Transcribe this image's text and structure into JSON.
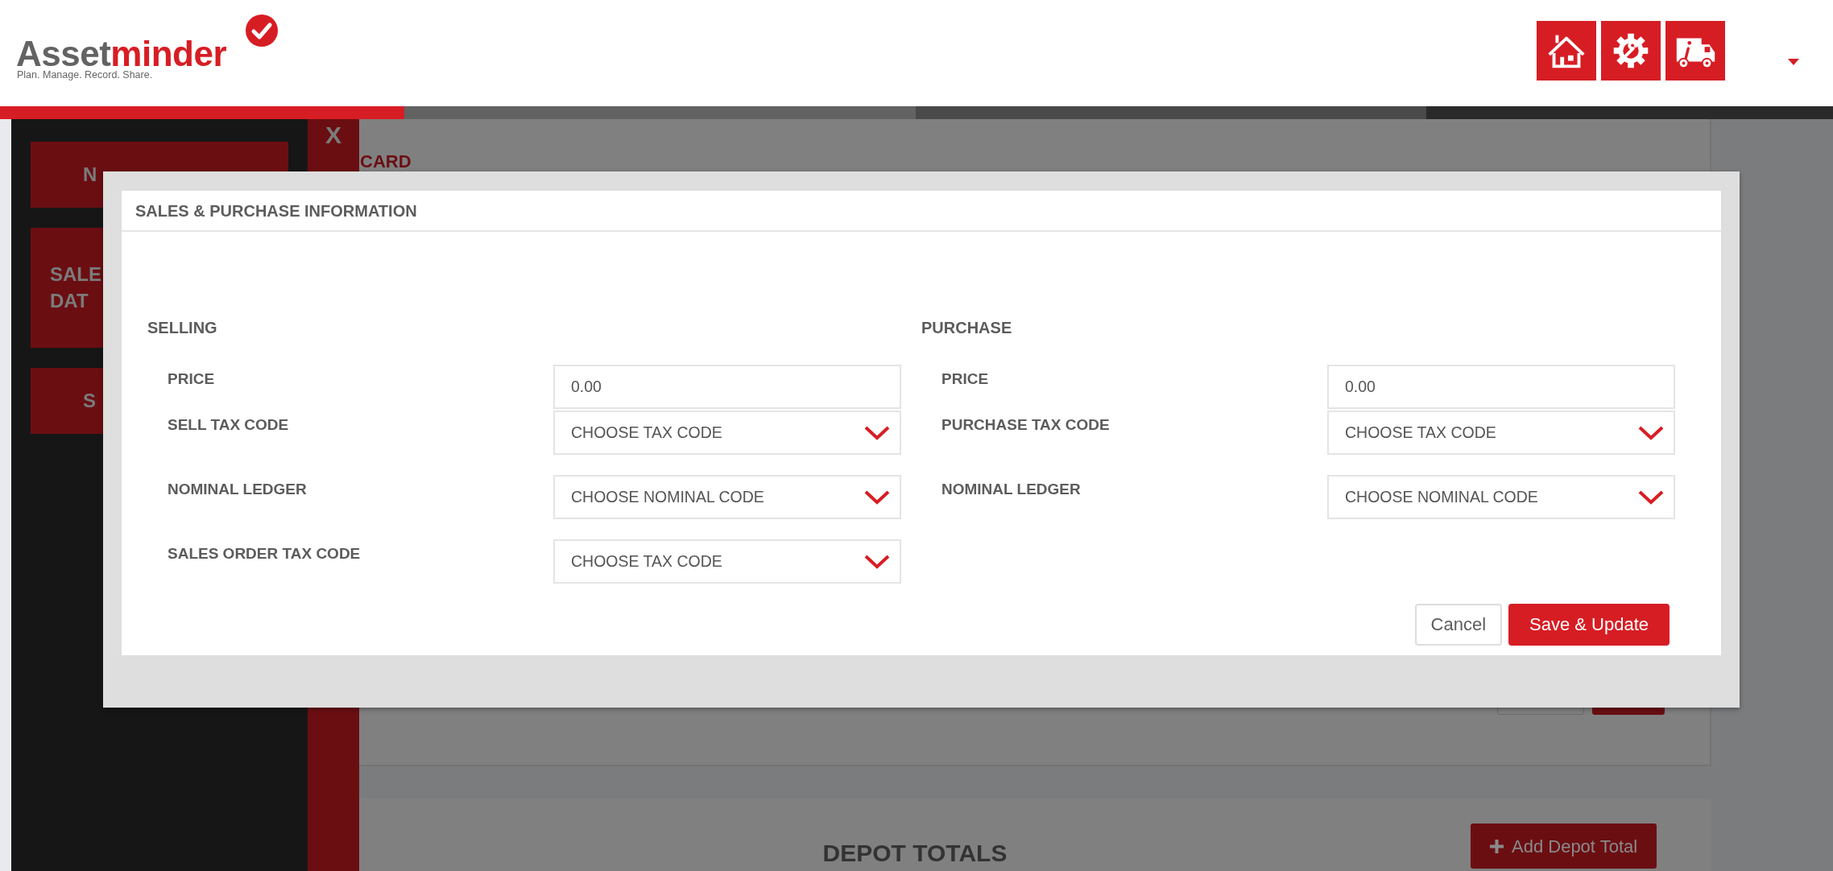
{
  "header": {
    "brand_first": "Asset",
    "brand_second": "minder",
    "tagline": "Plan. Manage. Record. Share.",
    "nav_icons": [
      {
        "kind": "home"
      },
      {
        "kind": "gear"
      },
      {
        "kind": "truck"
      }
    ]
  },
  "progress_steps": [
    {
      "color": "#d71d24"
    },
    {
      "color": "#626262"
    },
    {
      "color": "#4a4a4a"
    },
    {
      "color": "#2a2a2a"
    }
  ],
  "sidebar": {
    "items": [
      {
        "lines": [
          "N"
        ]
      },
      {
        "lines": [
          "SALE",
          "DAT"
        ]
      },
      {
        "lines": [
          "S"
        ]
      }
    ]
  },
  "close_label": "X",
  "card": {
    "title": "CARD",
    "buttons": [
      {
        "kind": "secondary"
      },
      {
        "kind": "primary"
      }
    ]
  },
  "depot": {
    "title": "DEPOT TOTALS",
    "add_button": "Add Depot Total"
  },
  "modal": {
    "title": "SALES & PURCHASE INFORMATION",
    "sections": [
      {
        "heading": "SELLING",
        "fields": [
          {
            "label": "PRICE",
            "kind": "input",
            "value": "0.00"
          },
          {
            "label": "SELL TAX CODE",
            "kind": "select",
            "value": "CHOOSE TAX CODE"
          },
          {
            "label": "NOMINAL LEDGER",
            "kind": "select",
            "value": "CHOOSE NOMINAL CODE"
          },
          {
            "label": "SALES ORDER TAX CODE",
            "kind": "select",
            "value": "CHOOSE TAX CODE"
          }
        ]
      },
      {
        "heading": "PURCHASE",
        "fields": [
          {
            "label": "PRICE",
            "kind": "input",
            "value": "0.00"
          },
          {
            "label": "PURCHASE TAX CODE",
            "kind": "select",
            "value": "CHOOSE TAX CODE"
          },
          {
            "label": "NOMINAL LEDGER",
            "kind": "select",
            "value": "CHOOSE NOMINAL CODE"
          }
        ]
      }
    ],
    "buttons": [
      {
        "label": "Cancel",
        "kind": "secondary"
      },
      {
        "label": "Save & Update",
        "kind": "primary"
      }
    ]
  }
}
